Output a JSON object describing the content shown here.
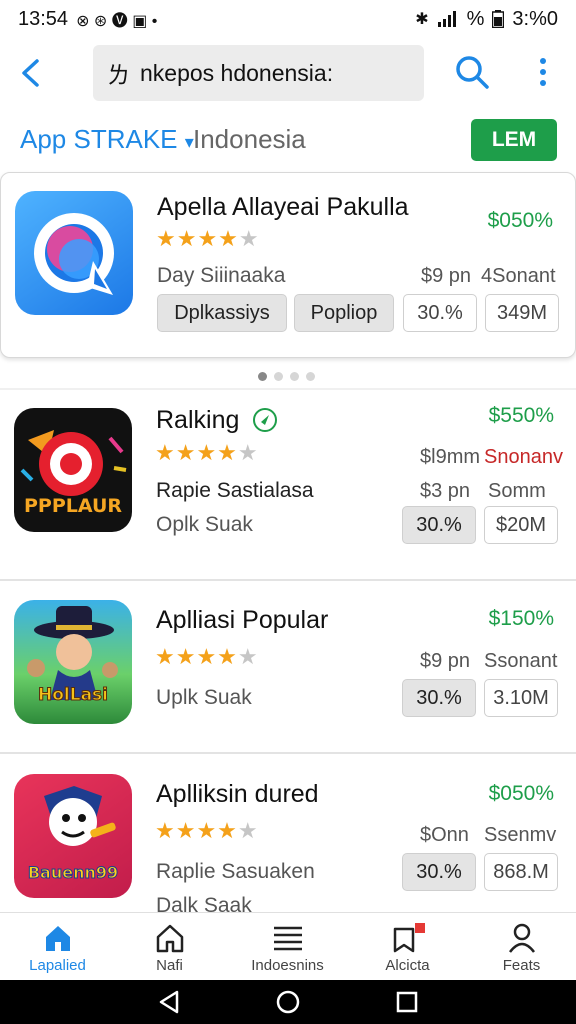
{
  "status_bar": {
    "time": "13:54",
    "right_text": "3:%0",
    "pct_text": "%"
  },
  "search": {
    "glyph": "ㄌ",
    "query": "nkepos hdonensia:"
  },
  "filters": {
    "store_tab": "App STRAKE",
    "region_tab": "Indonesia",
    "action_label": "LEM"
  },
  "apps": [
    {
      "title": "Apella Allayeai Pakulla",
      "percent": "$050%",
      "rating_stars": 4,
      "subtitle": "Day Siiinaaka",
      "price": "$9 pn",
      "price2": "4Sonant",
      "chip1": "Dplkassiys",
      "chip2": "Popliop",
      "chip3": "30.%",
      "chip4": "349M"
    },
    {
      "title": "Ralking",
      "percent": "$550%",
      "rating_stars": 4,
      "price_top": "$l9mm",
      "price_top2": "Snonanv",
      "subtitle_dark": "Rapie Sastialasa",
      "price": "$3 pn",
      "price2": "Somm",
      "subtitle": "Oplk Suak",
      "chip3": "30.%",
      "chip4": "$20M",
      "icon_text": "PPPLAUR"
    },
    {
      "title": "Aplliasi Popular",
      "percent": "$150%",
      "rating_stars": 4,
      "price": "$9 pn",
      "price2": "Ssonant",
      "subtitle": "Uplk Suak",
      "chip3": "30.%",
      "chip4": "3.10M",
      "icon_text": "HolLasi"
    },
    {
      "title": "Aplliksin dured",
      "percent": "$050%",
      "rating_stars": 4,
      "price": "$Onn",
      "price2": "Ssenmv",
      "subtitle": "Raplie Sasuaken",
      "subtitle2": "Dalk Saak",
      "chip3": "30.%",
      "chip4": "868.M",
      "icon_text": "Bauenn99"
    }
  ],
  "bottom_nav": [
    {
      "label": "Lapalied",
      "icon": "home-filled-icon",
      "active": true
    },
    {
      "label": "Nafi",
      "icon": "home-outline-icon",
      "active": false
    },
    {
      "label": "Indoesnins",
      "icon": "list-icon",
      "active": false
    },
    {
      "label": "Alcicta",
      "icon": "bookmark-icon",
      "active": false
    },
    {
      "label": "Feats",
      "icon": "person-icon",
      "active": false
    }
  ],
  "colors": {
    "accent": "#1e88e5",
    "green": "#1e9e4a",
    "red": "#c62828",
    "star": "#f4a11a"
  }
}
